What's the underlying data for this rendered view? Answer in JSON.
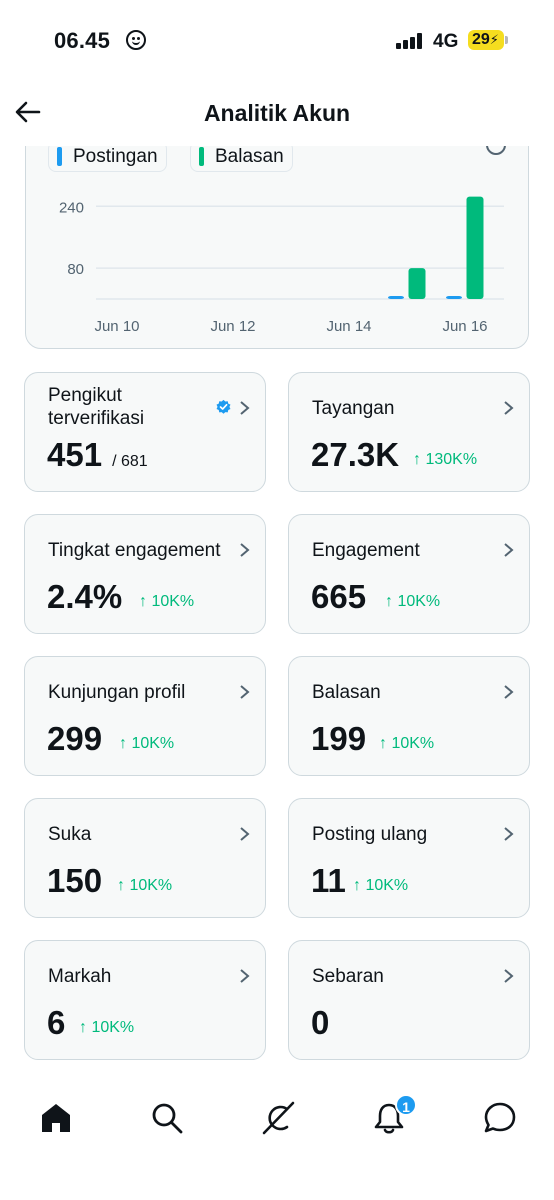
{
  "status_bar": {
    "time": "06.45",
    "network": "4G",
    "battery": "29"
  },
  "header": {
    "title": "Analitik Akun"
  },
  "chart_data": {
    "type": "bar",
    "legend": [
      {
        "name": "Postingan",
        "color": "#1d9bf0"
      },
      {
        "name": "Balasan",
        "color": "#00ba7c"
      }
    ],
    "x_tick_labels": [
      "Jun 10",
      "Jun 12",
      "Jun 14",
      "Jun 16"
    ],
    "y_tick_labels": [
      "240",
      "80"
    ],
    "ylim": [
      0,
      290
    ],
    "categories": [
      "Jun 10",
      "Jun 11",
      "Jun 12",
      "Jun 13",
      "Jun 14",
      "Jun 15",
      "Jun 16"
    ],
    "series": [
      {
        "name": "Postingan",
        "values": [
          0,
          0,
          0,
          0,
          0,
          1,
          2
        ]
      },
      {
        "name": "Balasan",
        "values": [
          0,
          0,
          0,
          0,
          0,
          80,
          265
        ]
      }
    ]
  },
  "cards": [
    {
      "label": "Pengikut terverifikasi",
      "value": "451",
      "sub": "/ 681",
      "growth": "",
      "verified": true
    },
    {
      "label": "Tayangan",
      "value": "27.3K",
      "sub": "",
      "growth": "↑ 130K%"
    },
    {
      "label": "Tingkat engagement",
      "value": "2.4%",
      "sub": "",
      "growth": "↑ 10K%"
    },
    {
      "label": "Engagement",
      "value": "665",
      "sub": "",
      "growth": "↑ 10K%"
    },
    {
      "label": "Kunjungan profil",
      "value": "299",
      "sub": "",
      "growth": "↑ 10K%"
    },
    {
      "label": "Balasan",
      "value": "199",
      "sub": "",
      "growth": "↑ 10K%"
    },
    {
      "label": "Suka",
      "value": "150",
      "sub": "",
      "growth": "↑ 10K%"
    },
    {
      "label": "Posting ulang",
      "value": "11",
      "sub": "",
      "growth": "↑ 10K%"
    },
    {
      "label": "Markah",
      "value": "6",
      "sub": "",
      "growth": "↑ 10K%"
    },
    {
      "label": "Sebaran",
      "value": "0",
      "sub": "",
      "growth": ""
    }
  ],
  "bottom_nav": {
    "items": [
      "home-icon",
      "search-icon",
      "grok-icon",
      "notifications-icon",
      "messages-icon"
    ],
    "notification_count": "1"
  }
}
